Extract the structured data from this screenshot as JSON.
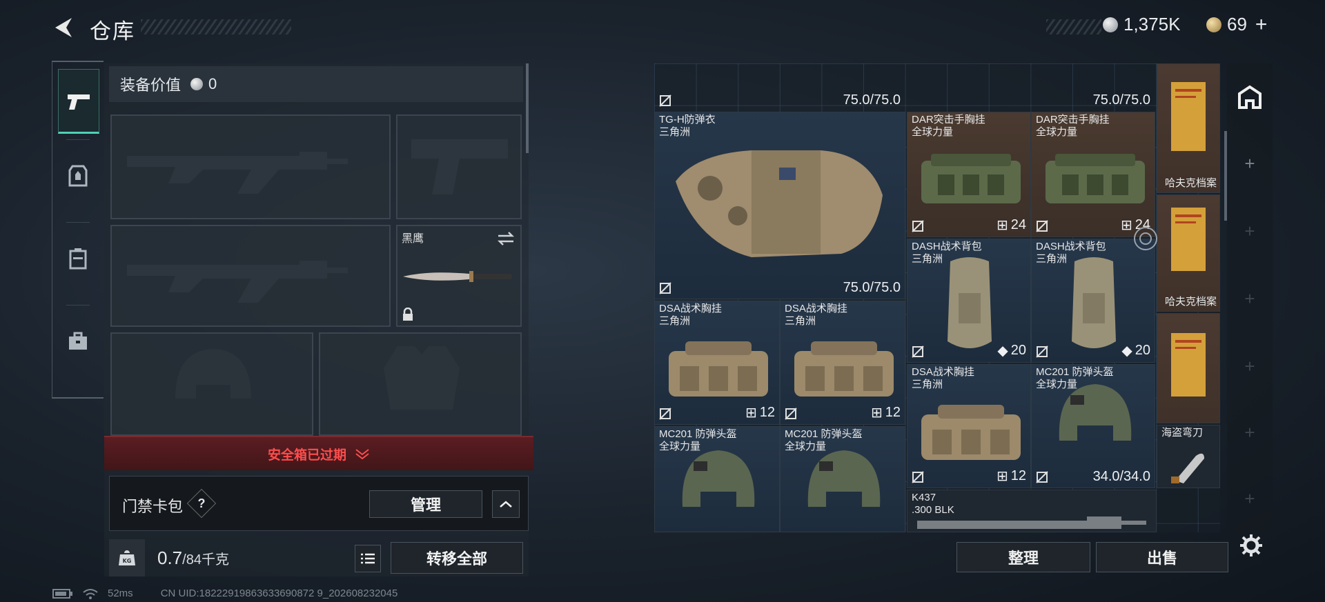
{
  "header": {
    "title": "仓库"
  },
  "currency": {
    "silver": "1,375K",
    "gold": "69"
  },
  "loadout": {
    "value_label": "装备价值",
    "value": "0",
    "knife_name": "黑鹰",
    "alert": "安全箱已过期",
    "keycard_label": "门禁卡包",
    "help": "?",
    "manage_label": "管理",
    "weight_current": "0.7",
    "weight_cap": "/84千克",
    "transfer_label": "转移全部"
  },
  "inventory": {
    "top_dur_1": "75.0/75.0",
    "top_dur_2": "75.0/75.0",
    "items": [
      {
        "name": "TG-H防弹衣",
        "sub": "三角洲",
        "dur": "75.0/75.0"
      },
      {
        "name": "DAR突击手胸挂",
        "sub": "全球力量",
        "cap": "24"
      },
      {
        "name": "DAR突击手胸挂",
        "sub": "全球力量",
        "cap": "24"
      },
      {
        "name": "哈夫克档案"
      },
      {
        "name": "DASH战术背包",
        "sub": "三角洲",
        "cap": "20"
      },
      {
        "name": "DASH战术背包",
        "sub": "三角洲",
        "cap": "20"
      },
      {
        "name": "哈夫克档案"
      },
      {
        "name": "DSA战术胸挂",
        "sub": "三角洲",
        "cap": "12"
      },
      {
        "name": "DSA战术胸挂",
        "sub": "三角洲",
        "cap": "12"
      },
      {
        "name": "DSA战术胸挂",
        "sub": "三角洲",
        "cap": "12"
      },
      {
        "name": "MC201 防弹头盔",
        "sub": "全球力量",
        "dur": "34.0/34.0"
      },
      {
        "name": "MC201 防弹头盔",
        "sub": "全球力量"
      },
      {
        "name": "MC201 防弹头盔",
        "sub": "全球力量"
      },
      {
        "name": "海盗弯刀"
      },
      {
        "name": "K437",
        "sub": ".300 BLK"
      }
    ],
    "sort_label": "整理",
    "sell_label": "出售"
  },
  "status": {
    "ping": "52ms",
    "uid": "CN UID:18222919863633690872 9_202608232045"
  },
  "colors": {
    "accent": "#4fd1b7",
    "alert": "#ff4d4d"
  }
}
